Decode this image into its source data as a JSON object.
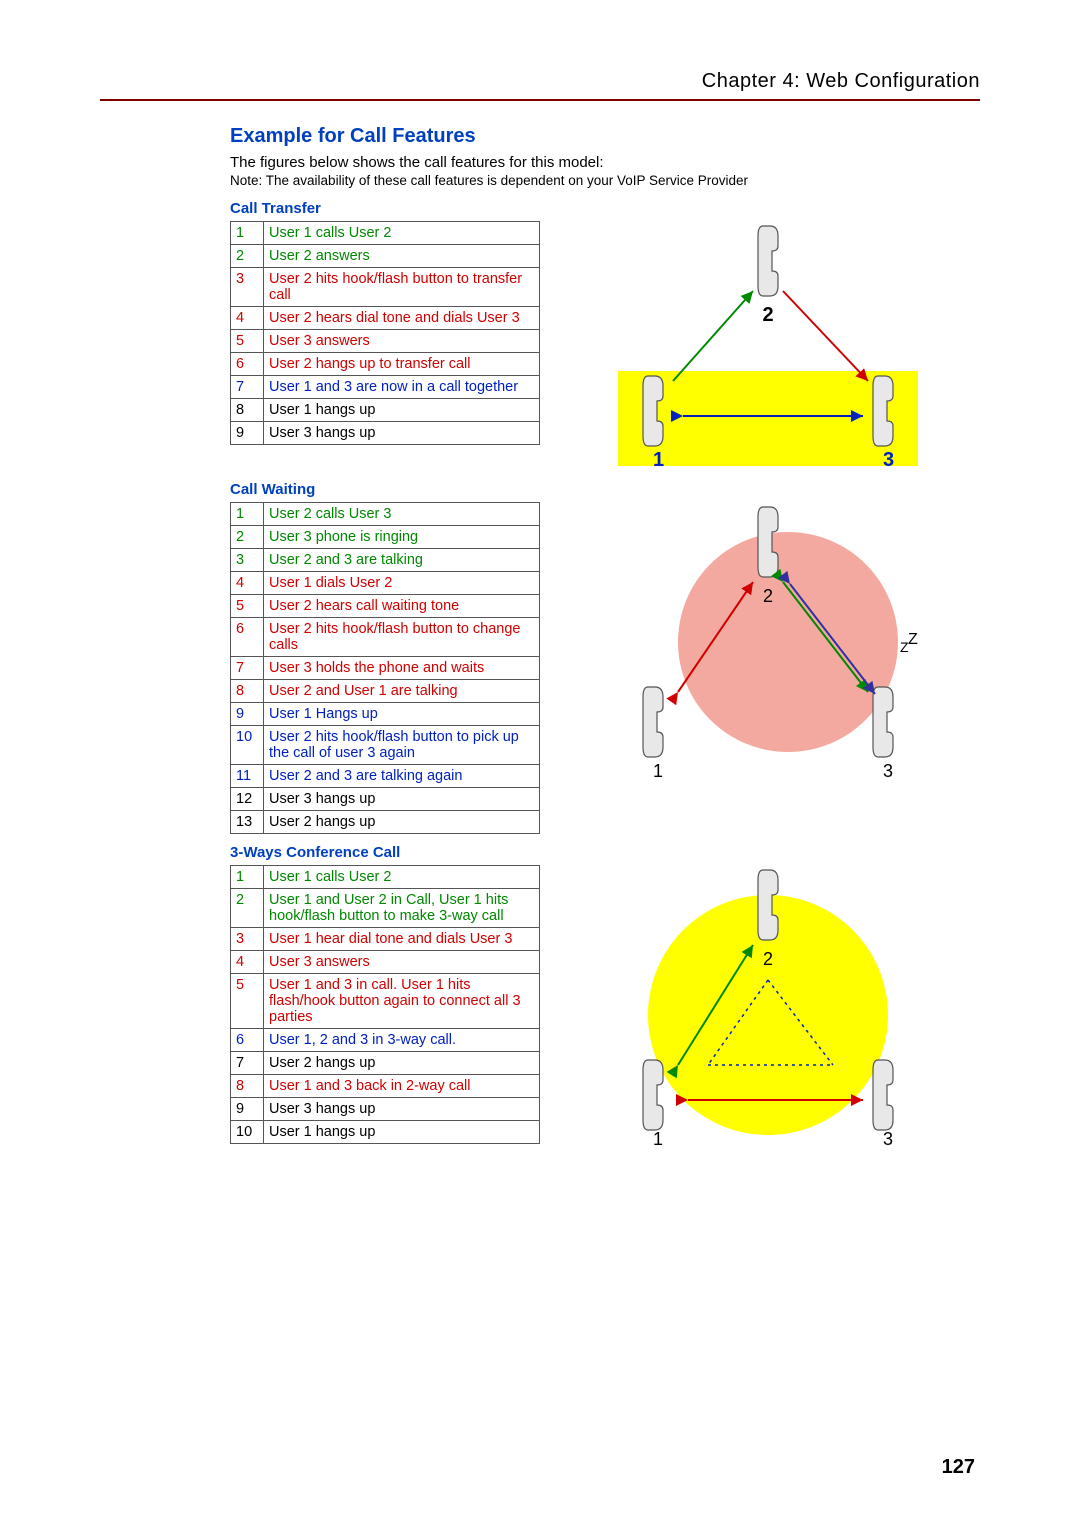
{
  "chapter": "Chapter 4: Web Configuration",
  "section_title": "Example for Call Features",
  "intro": "The figures below shows the call features for this model:",
  "note": "Note: The availability of these call features is dependent on your VoIP Service Provider",
  "page_number": "127",
  "features": [
    {
      "title": "Call Transfer",
      "steps": [
        {
          "n": "1",
          "text": "User 1 calls User 2",
          "cls": "green"
        },
        {
          "n": "2",
          "text": "User 2 answers",
          "cls": "green"
        },
        {
          "n": "3",
          "text": "User 2 hits hook/flash button to transfer call",
          "cls": "red"
        },
        {
          "n": "4",
          "text": "User 2 hears dial tone and dials User 3",
          "cls": "red"
        },
        {
          "n": "5",
          "text": "User 3 answers",
          "cls": "red"
        },
        {
          "n": "6",
          "text": "User 2 hangs up to transfer call",
          "cls": "red"
        },
        {
          "n": "7",
          "text": "User 1 and 3 are now in a call together",
          "cls": "blue"
        },
        {
          "n": "8",
          "text": "User 1 hangs up",
          "cls": "black"
        },
        {
          "n": "9",
          "text": "User 3 hangs up",
          "cls": "black"
        }
      ],
      "diagram": "transfer"
    },
    {
      "title": "Call Waiting",
      "steps": [
        {
          "n": "1",
          "text": "User 2 calls User 3",
          "cls": "green"
        },
        {
          "n": "2",
          "text": "User 3 phone is ringing",
          "cls": "green"
        },
        {
          "n": "3",
          "text": "User 2 and 3 are talking",
          "cls": "green"
        },
        {
          "n": "4",
          "text": "User 1 dials User 2",
          "cls": "red"
        },
        {
          "n": "5",
          "text": "User 2 hears call waiting tone",
          "cls": "red"
        },
        {
          "n": "6",
          "text": "User 2 hits hook/flash button to change calls",
          "cls": "red"
        },
        {
          "n": "7",
          "text": "User 3 holds the phone and waits",
          "cls": "red"
        },
        {
          "n": "8",
          "text": "User 2 and User 1 are talking",
          "cls": "red"
        },
        {
          "n": "9",
          "text": "User 1 Hangs up",
          "cls": "blue"
        },
        {
          "n": "10",
          "text": "User 2 hits hook/flash button to pick up the call of user 3 again",
          "cls": "blue"
        },
        {
          "n": "11",
          "text": "User 2 and 3 are talking again",
          "cls": "blue"
        },
        {
          "n": "12",
          "text": "User 3 hangs up",
          "cls": "black"
        },
        {
          "n": "13",
          "text": "User 2 hangs up",
          "cls": "black"
        }
      ],
      "diagram": "waiting"
    },
    {
      "title": "3-Ways Conference Call",
      "steps": [
        {
          "n": "1",
          "text": "User 1 calls User 2",
          "cls": "green"
        },
        {
          "n": "2",
          "text": "User 1 and User 2 in Call, User 1 hits hook/flash button to make 3-way call",
          "cls": "green"
        },
        {
          "n": "3",
          "text": "User 1 hear dial tone and dials User 3",
          "cls": "red"
        },
        {
          "n": "4",
          "text": "User 3 answers",
          "cls": "red"
        },
        {
          "n": "5",
          "text": "User 1 and 3 in call. User 1 hits flash/hook button again to connect all 3 parties",
          "cls": "red"
        },
        {
          "n": "6",
          "text": "User 1, 2 and 3 in 3-way call.",
          "cls": "blue"
        },
        {
          "n": "7",
          "text": "User 2 hangs up",
          "cls": "black"
        },
        {
          "n": "8",
          "text": "User 1 and 3 back in 2-way call",
          "cls": "red"
        },
        {
          "n": "9",
          "text": "User 3 hangs up",
          "cls": "black"
        },
        {
          "n": "10",
          "text": "User 1 hangs up",
          "cls": "black"
        }
      ],
      "diagram": "conference"
    }
  ]
}
